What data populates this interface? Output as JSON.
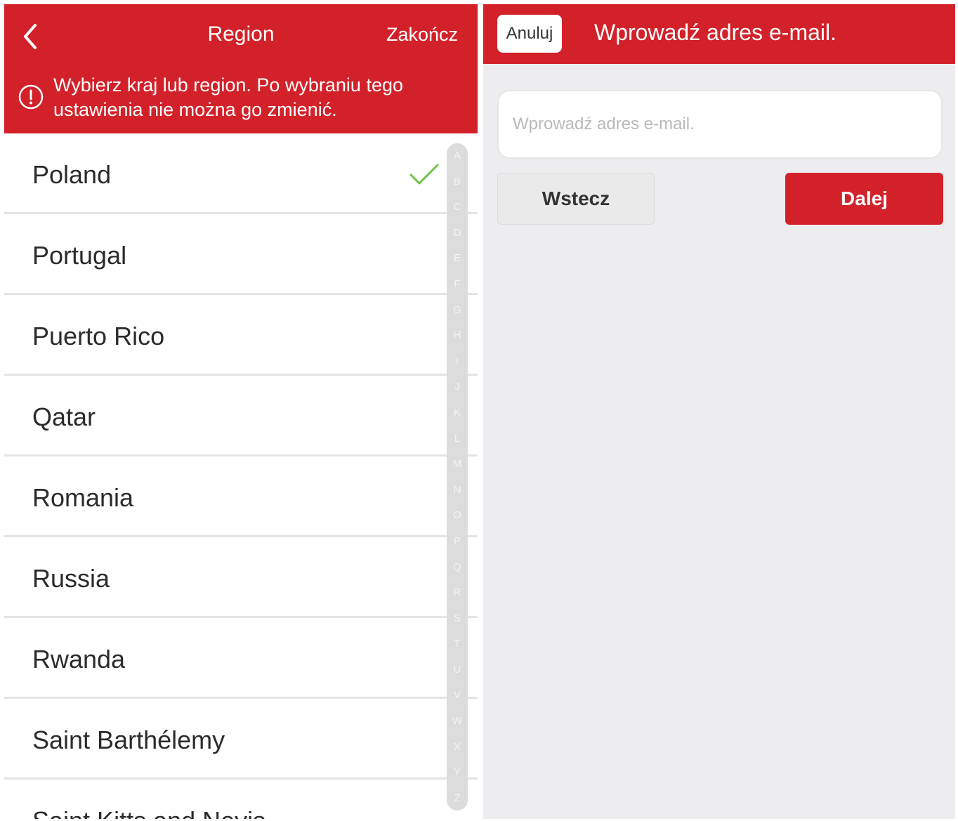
{
  "left": {
    "header": {
      "title": "Region",
      "finish_label": "Zakończ",
      "notice": "Wybierz kraj lub region. Po wybraniu tego ustawienia nie można go zmienić."
    },
    "countries": [
      {
        "name": "Poland",
        "selected": true
      },
      {
        "name": "Portugal",
        "selected": false
      },
      {
        "name": "Puerto Rico",
        "selected": false
      },
      {
        "name": "Qatar",
        "selected": false
      },
      {
        "name": "Romania",
        "selected": false
      },
      {
        "name": "Russia",
        "selected": false
      },
      {
        "name": "Rwanda",
        "selected": false
      },
      {
        "name": "Saint Barthélemy",
        "selected": false
      },
      {
        "name": "Saint Kitts and Nevis",
        "selected": false
      }
    ],
    "alphabet": [
      "A",
      "B",
      "C",
      "D",
      "E",
      "F",
      "G",
      "H",
      "I",
      "J",
      "K",
      "L",
      "M",
      "N",
      "O",
      "P",
      "Q",
      "R",
      "S",
      "T",
      "U",
      "V",
      "W",
      "X",
      "Y",
      "Z"
    ]
  },
  "right": {
    "header": {
      "cancel_label": "Anuluj",
      "title": "Wprowadź adres e-mail."
    },
    "email": {
      "value": "",
      "placeholder": "Wprowadź adres e-mail."
    },
    "back_label": "Wstecz",
    "next_label": "Dalej"
  },
  "colors": {
    "brand_red": "#d3212a",
    "check_green": "#6fc14b"
  }
}
